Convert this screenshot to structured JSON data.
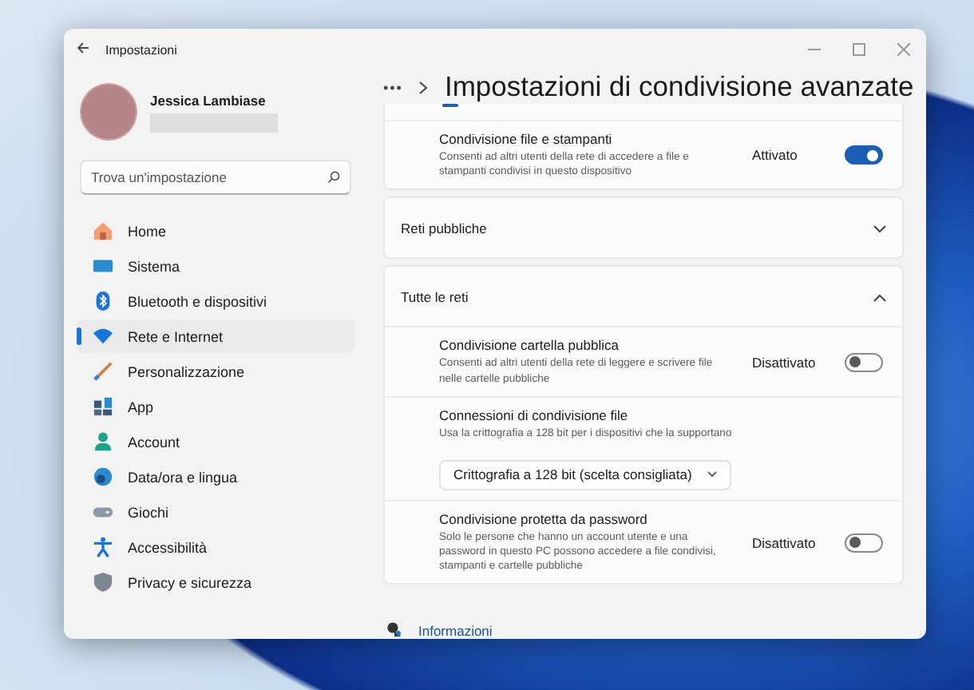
{
  "window": {
    "title": "Impostazioni"
  },
  "user": {
    "name": "Jessica Lambiase"
  },
  "search": {
    "placeholder": "Trova un'impostazione"
  },
  "nav": [
    {
      "label": "Home",
      "selected": false
    },
    {
      "label": "Sistema",
      "selected": false
    },
    {
      "label": "Bluetooth e dispositivi",
      "selected": false
    },
    {
      "label": "Rete e Internet",
      "selected": true
    },
    {
      "label": "Personalizzazione",
      "selected": false
    },
    {
      "label": "App",
      "selected": false
    },
    {
      "label": "Account",
      "selected": false
    },
    {
      "label": "Data/ora e lingua",
      "selected": false
    },
    {
      "label": "Giochi",
      "selected": false
    },
    {
      "label": "Accessibilità",
      "selected": false
    },
    {
      "label": "Privacy e sicurezza",
      "selected": false
    }
  ],
  "breadcrumb": {
    "more": "•••",
    "title": "Impostazioni di condivisione avanzate"
  },
  "cards": [
    {
      "kind": "partial",
      "rows": [
        {
          "kind": "toggle",
          "title": "Condivisione file e stampanti",
          "description": "Consenti ad altri utenti della rete di accedere a file e stampanti condivisi in questo dispositivo",
          "state": "Attivato",
          "on": true
        }
      ]
    },
    {
      "kind": "group",
      "title": "Reti pubbliche",
      "expanded": false
    },
    {
      "kind": "group",
      "title": "Tutte le reti",
      "expanded": true,
      "rows": [
        {
          "kind": "toggle",
          "title": "Condivisione cartella pubblica",
          "description": "Consenti ad altri utenti della rete di leggere e scrivere file nelle cartelle pubbliche",
          "state": "Disattivato",
          "on": false
        },
        {
          "kind": "dropdown",
          "title": "Connessioni di condivisione file",
          "description": "Usa la crittografia a 128 bit per i dispositivi che la supportano",
          "value": "Crittografia a 128 bit (scelta consigliata)"
        },
        {
          "kind": "toggle",
          "title": "Condivisione protetta da password",
          "description": "Solo le persone che hanno un account utente e una password in questo PC possono accedere a file condivisi, stampanti e cartelle pubbliche",
          "state": "Disattivato",
          "on": false
        }
      ]
    }
  ],
  "footer_link": "Informazioni"
}
